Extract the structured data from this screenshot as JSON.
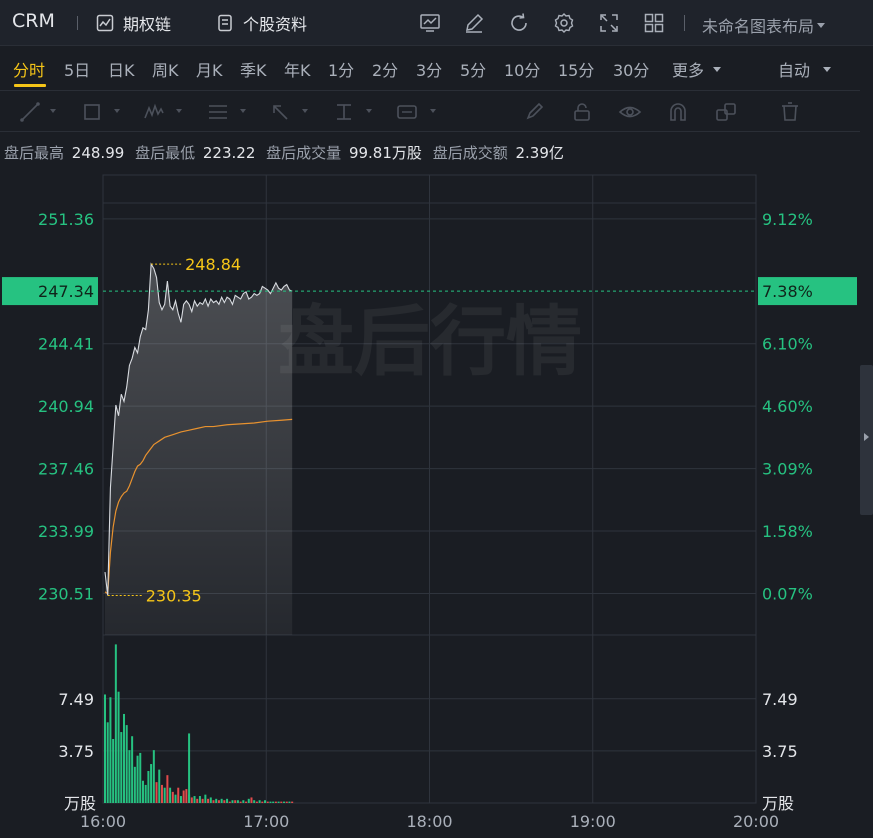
{
  "header": {
    "ticker": "CRM",
    "options_chain_label": "期权链",
    "profile_label": "个股资料",
    "layout_label": "未命名图表布局",
    "tools": [
      "chart-icon",
      "pen-icon",
      "refresh-icon",
      "gear-icon",
      "fullscreen-icon",
      "grid-icon"
    ]
  },
  "periods": [
    "分时",
    "5日",
    "日K",
    "周K",
    "月K",
    "季K",
    "年K",
    "1分",
    "2分",
    "3分",
    "5分",
    "10分",
    "15分",
    "30分",
    "更多"
  ],
  "active_period": "分时",
  "auto_label": "自动",
  "draw_tools": [
    "line-tool-icon",
    "rect-tool-icon",
    "wave-tool-icon",
    "fib-tool-icon",
    "arrow-tool-icon",
    "text-marker-icon",
    "label-tool-icon",
    "brush-icon",
    "lock-icon",
    "eye-icon",
    "magnet-icon",
    "layers-icon",
    "trash-icon"
  ],
  "stats": {
    "high_label": "盘后最高",
    "high_value": "248.99",
    "low_label": "盘后最低",
    "low_value": "223.22",
    "vol_label": "盘后成交量",
    "vol_value": "99.81万股",
    "amt_label": "盘后成交额",
    "amt_value": "2.39亿"
  },
  "watermark": "盘后行情",
  "colors": {
    "accent": "#f5c518",
    "up": "#26c281",
    "down": "#e24b4b",
    "avg_line": "#e8922f",
    "price_line": "#d8dbe0",
    "current_tag": "#26c281"
  },
  "chart_data": {
    "type": "line",
    "x_ticks": [
      "16:00",
      "17:00",
      "18:00",
      "19:00",
      "20:00"
    ],
    "x_range": [
      "16:00",
      "20:00"
    ],
    "price_ticks": [
      "251.36",
      "247.34",
      "244.41",
      "240.94",
      "237.46",
      "233.99",
      "230.51"
    ],
    "pct_ticks": [
      "9.12%",
      "7.38%",
      "6.10%",
      "4.60%",
      "3.09%",
      "1.58%",
      "0.07%"
    ],
    "current_price": "247.34",
    "current_pct": "7.38%",
    "max_label": "248.84",
    "min_label": "230.35",
    "ylim": [
      228.2,
      253.8
    ],
    "price_series": [
      [
        0,
        231.7
      ],
      [
        1,
        230.4
      ],
      [
        2,
        236.4
      ],
      [
        3,
        238.7
      ],
      [
        4,
        241.0
      ],
      [
        5,
        240.4
      ],
      [
        6,
        241.6
      ],
      [
        7,
        241.2
      ],
      [
        8,
        242.0
      ],
      [
        9,
        243.2
      ],
      [
        10,
        243.6
      ],
      [
        11,
        244.2
      ],
      [
        12,
        243.9
      ],
      [
        13,
        244.8
      ],
      [
        14,
        245.3
      ],
      [
        15,
        245.2
      ],
      [
        16,
        246.3
      ],
      [
        17,
        248.84
      ],
      [
        18,
        248.6
      ],
      [
        19,
        248.1
      ],
      [
        20,
        246.7
      ],
      [
        21,
        246.3
      ],
      [
        22,
        246.6
      ],
      [
        23,
        247.9
      ],
      [
        24,
        246.5
      ],
      [
        25,
        246.3
      ],
      [
        26,
        246.8
      ],
      [
        27,
        246.1
      ],
      [
        28,
        245.6
      ],
      [
        29,
        246.6
      ],
      [
        30,
        246.8
      ],
      [
        31,
        246.6
      ],
      [
        32,
        246.2
      ],
      [
        33,
        246.8
      ],
      [
        34,
        246.5
      ],
      [
        35,
        246.7
      ],
      [
        36,
        246.6
      ],
      [
        37,
        246.9
      ],
      [
        38,
        246.5
      ],
      [
        39,
        246.9
      ],
      [
        40,
        246.7
      ],
      [
        41,
        246.8
      ],
      [
        42,
        246.6
      ],
      [
        43,
        247.0
      ],
      [
        44,
        246.7
      ],
      [
        45,
        247.0
      ],
      [
        46,
        246.9
      ],
      [
        47,
        246.6
      ],
      [
        48,
        247.1
      ],
      [
        49,
        247.0
      ],
      [
        50,
        246.9
      ],
      [
        51,
        247.2
      ],
      [
        52,
        247.3
      ],
      [
        53,
        246.9
      ],
      [
        54,
        247.0
      ],
      [
        55,
        247.2
      ],
      [
        56,
        247.1
      ],
      [
        57,
        247.2
      ],
      [
        58,
        247.6
      ],
      [
        59,
        247.5
      ],
      [
        60,
        247.4
      ],
      [
        61,
        247.2
      ],
      [
        62,
        247.5
      ],
      [
        63,
        247.8
      ],
      [
        64,
        247.5
      ],
      [
        65,
        247.4
      ],
      [
        66,
        247.6
      ],
      [
        67,
        247.7
      ],
      [
        68,
        247.4
      ],
      [
        69,
        247.34
      ]
    ],
    "avg_series": [
      [
        0,
        230.6
      ],
      [
        1,
        230.5
      ],
      [
        2,
        232.8
      ],
      [
        3,
        234.2
      ],
      [
        4,
        235.1
      ],
      [
        5,
        235.6
      ],
      [
        6,
        235.9
      ],
      [
        7,
        236.1
      ],
      [
        8,
        236.2
      ],
      [
        9,
        236.5
      ],
      [
        10,
        236.9
      ],
      [
        11,
        237.3
      ],
      [
        12,
        237.6
      ],
      [
        13,
        237.7
      ],
      [
        14,
        237.9
      ],
      [
        15,
        238.2
      ],
      [
        16,
        238.4
      ],
      [
        17,
        238.6
      ],
      [
        18,
        238.8
      ],
      [
        19,
        238.9
      ],
      [
        20,
        239.0
      ],
      [
        22,
        239.2
      ],
      [
        25,
        239.35
      ],
      [
        28,
        239.5
      ],
      [
        31,
        239.6
      ],
      [
        34,
        239.7
      ],
      [
        37,
        239.8
      ],
      [
        40,
        239.8
      ],
      [
        45,
        239.9
      ],
      [
        50,
        239.95
      ],
      [
        55,
        240.0
      ],
      [
        60,
        240.1
      ],
      [
        65,
        240.15
      ],
      [
        69,
        240.2
      ]
    ],
    "volume_ticks": [
      "7.49",
      "3.75",
      "万股"
    ],
    "volume_ylim": [
      0,
      11.5
    ],
    "volume": [
      [
        0,
        7.8,
        "up"
      ],
      [
        1,
        5.8,
        "up"
      ],
      [
        2,
        7.6,
        "up"
      ],
      [
        3,
        4.6,
        "up"
      ],
      [
        4,
        11.4,
        "up"
      ],
      [
        5,
        8.0,
        "up"
      ],
      [
        6,
        5.1,
        "up"
      ],
      [
        7,
        6.4,
        "up"
      ],
      [
        8,
        5.6,
        "up"
      ],
      [
        9,
        3.8,
        "up"
      ],
      [
        10,
        4.8,
        "up"
      ],
      [
        11,
        2.6,
        "up"
      ],
      [
        12,
        3.4,
        "up"
      ],
      [
        13,
        3.6,
        "up"
      ],
      [
        14,
        1.6,
        "up"
      ],
      [
        15,
        1.3,
        "up"
      ],
      [
        16,
        2.3,
        "up"
      ],
      [
        17,
        2.8,
        "up"
      ],
      [
        18,
        3.8,
        "up"
      ],
      [
        19,
        1.5,
        "down"
      ],
      [
        20,
        2.4,
        "up"
      ],
      [
        21,
        1.3,
        "down"
      ],
      [
        22,
        1.1,
        "up"
      ],
      [
        23,
        2.0,
        "down"
      ],
      [
        24,
        1.1,
        "up"
      ],
      [
        25,
        0.8,
        "down"
      ],
      [
        26,
        0.6,
        "up"
      ],
      [
        27,
        1.1,
        "down"
      ],
      [
        28,
        0.5,
        "up"
      ],
      [
        29,
        0.9,
        "down"
      ],
      [
        30,
        1.0,
        "down"
      ],
      [
        31,
        0.6,
        "up"
      ],
      [
        32,
        0.4,
        "down"
      ],
      [
        33,
        0.5,
        "up"
      ],
      [
        34,
        0.3,
        "down"
      ],
      [
        35,
        0.5,
        "up"
      ],
      [
        36,
        0.3,
        "down"
      ],
      [
        37,
        0.6,
        "up"
      ],
      [
        38,
        0.3,
        "down"
      ],
      [
        39,
        0.4,
        "up"
      ],
      [
        40,
        0.2,
        "down"
      ],
      [
        41,
        0.3,
        "up"
      ],
      [
        42,
        0.2,
        "down"
      ],
      [
        43,
        0.3,
        "up"
      ],
      [
        44,
        0.2,
        "down"
      ],
      [
        45,
        0.3,
        "up"
      ],
      [
        46,
        0.1,
        "down"
      ],
      [
        47,
        0.2,
        "up"
      ],
      [
        48,
        0.2,
        "down"
      ],
      [
        49,
        0.2,
        "up"
      ],
      [
        50,
        0.1,
        "down"
      ],
      [
        51,
        0.2,
        "up"
      ],
      [
        52,
        0.1,
        "down"
      ],
      [
        53,
        0.3,
        "up"
      ],
      [
        54,
        0.4,
        "down"
      ],
      [
        55,
        0.2,
        "up"
      ],
      [
        56,
        0.1,
        "down"
      ],
      [
        57,
        0.2,
        "up"
      ],
      [
        58,
        0.1,
        "down"
      ],
      [
        59,
        0.2,
        "up"
      ],
      [
        60,
        0.1,
        "down"
      ],
      [
        61,
        0.1,
        "up"
      ],
      [
        62,
        0.1,
        "up"
      ],
      [
        63,
        0.1,
        "down"
      ],
      [
        64,
        0.1,
        "up"
      ],
      [
        65,
        0.1,
        "down"
      ],
      [
        66,
        0.1,
        "up"
      ],
      [
        67,
        0.1,
        "down"
      ],
      [
        68,
        0.1,
        "up"
      ],
      [
        69,
        0.1,
        "down"
      ]
    ],
    "volume_spike": [
      [
        31,
        5.0,
        "up"
      ]
    ],
    "volume_unit": "万股",
    "time_span_minutes": 240,
    "elapsed_minutes": 69
  }
}
